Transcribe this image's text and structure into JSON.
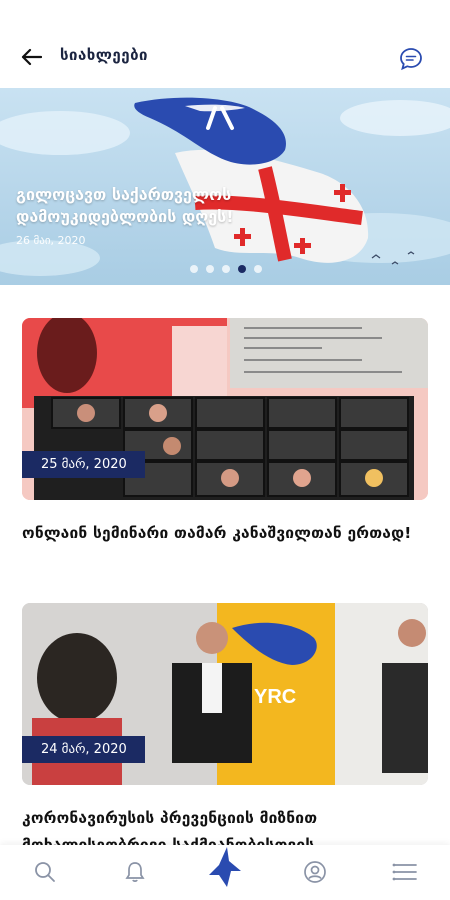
{
  "header": {
    "title": "სიახლეები"
  },
  "hero": {
    "title": "გილოცავთ საქართველოს დამოუკიდებლობის დღეს!",
    "date": "26 მაი, 2020",
    "slides": 5,
    "active_slide": 4
  },
  "news": [
    {
      "date": "25 მარ, 2020",
      "title": "ონლაინ სემინარი თამარ კანაშვილთან ერთად!"
    },
    {
      "date": "24 მარ, 2020",
      "title": "კორონავირუსის პრევენციის მიზნით მოხალისეობრივი საქმიანობისთვის"
    }
  ],
  "colors": {
    "navy": "#1b2a63",
    "accent": "#2a4bb0",
    "flag_red": "#e02a2a"
  }
}
